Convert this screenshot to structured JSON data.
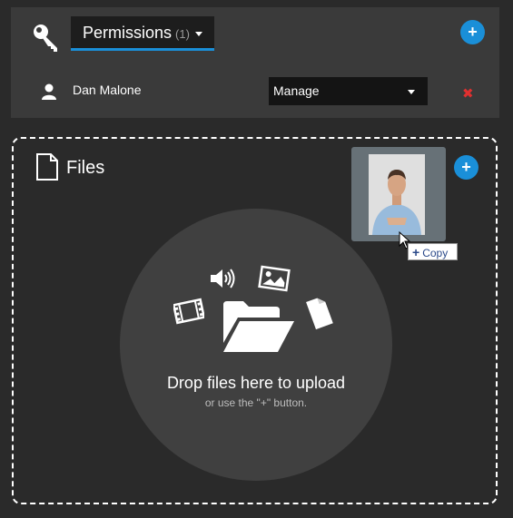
{
  "permissions": {
    "title": "Permissions",
    "count": "(1)",
    "add_button": "+",
    "entries": [
      {
        "user": "Dan Malone",
        "role": "Manage",
        "remove": "✖"
      }
    ]
  },
  "files": {
    "title": "Files",
    "add_button": "+",
    "drop_title": "Drop files here to upload",
    "drop_subtitle": "or use the \"+\" button."
  },
  "drag": {
    "tooltip_icon": "+",
    "tooltip_label": "Copy"
  },
  "colors": {
    "accent": "#1a8fd8",
    "remove": "#e03030"
  },
  "icons": [
    "key-icon",
    "caret-down-icon",
    "plus-icon",
    "user-icon",
    "close-icon",
    "file-icon",
    "folder-open-icon",
    "film-icon",
    "audio-icon",
    "image-icon",
    "document-icon",
    "cursor-icon"
  ]
}
